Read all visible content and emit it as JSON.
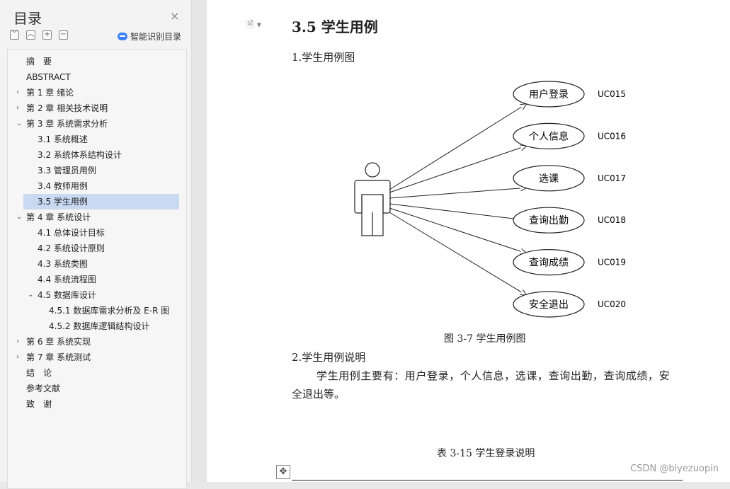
{
  "sidebar": {
    "title": "目录",
    "close_symbol": "×",
    "tools": [
      "﹀",
      "︿",
      "+",
      "−"
    ],
    "smart_label": "智能识别目录",
    "items": [
      {
        "label": "摘　要",
        "level": 1,
        "arrow": ""
      },
      {
        "label": "ABSTRACT",
        "level": 1,
        "arrow": ""
      },
      {
        "label": "第 1 章  绪论",
        "level": 1,
        "arrow": "›"
      },
      {
        "label": "第 2 章  相关技术说明",
        "level": 1,
        "arrow": "›"
      },
      {
        "label": "第 3 章  系统需求分析",
        "level": 1,
        "arrow": "⌄"
      },
      {
        "label": "3.1 系统概述",
        "level": 2,
        "arrow": ""
      },
      {
        "label": "3.2 系统体系结构设计",
        "level": 2,
        "arrow": ""
      },
      {
        "label": "3.3 管理员用例",
        "level": 2,
        "arrow": ""
      },
      {
        "label": "3.4 教师用例",
        "level": 2,
        "arrow": ""
      },
      {
        "label": "3.5 学生用例",
        "level": 2,
        "arrow": "",
        "selected": true
      },
      {
        "label": "第 4 章  系统设计",
        "level": 1,
        "arrow": "⌄"
      },
      {
        "label": "4.1 总体设计目标",
        "level": 2,
        "arrow": ""
      },
      {
        "label": "4.2 系统设计原则",
        "level": 2,
        "arrow": ""
      },
      {
        "label": "4.3 系统类图",
        "level": 2,
        "arrow": ""
      },
      {
        "label": "4.4 系统流程图",
        "level": 2,
        "arrow": ""
      },
      {
        "label": "4.5 数据库设计",
        "level": 2,
        "arrow": "⌄"
      },
      {
        "label": "4.5.1 数据库需求分析及 E-R 图",
        "level": 3,
        "arrow": ""
      },
      {
        "label": "4.5.2  数据库逻辑结构设计",
        "level": 3,
        "arrow": ""
      },
      {
        "label": "第 6 章  系统实现",
        "level": 1,
        "arrow": "›"
      },
      {
        "label": "第 7 章  系统测试",
        "level": 1,
        "arrow": "›"
      },
      {
        "label": "结　论",
        "level": 1,
        "arrow": ""
      },
      {
        "label": "参考文献",
        "level": 1,
        "arrow": ""
      },
      {
        "label": "致　谢",
        "level": 1,
        "arrow": ""
      }
    ]
  },
  "document": {
    "doc_icon": "🗎 ▾",
    "heading": "3.5 学生用例",
    "sub1": "1.学生用例图",
    "figure_caption": "图 3-7   学生用例图",
    "sub2": "2.学生用例说明",
    "para_line1": "学生用例主要有：用户登录，个人信息，选课，查询出勤，查询成绩，安",
    "para_line2": "全退出等。",
    "table_caption": "表 3-15   学生登录说明",
    "move_symbol": "✥"
  },
  "diagram": {
    "use_cases": [
      {
        "label": "用户登录",
        "code": "UC015"
      },
      {
        "label": "个人信息",
        "code": "UC016"
      },
      {
        "label": "选课",
        "code": "UC017"
      },
      {
        "label": "查询出勤",
        "code": "UC018"
      },
      {
        "label": "查询成绩",
        "code": "UC019"
      },
      {
        "label": "安全退出",
        "code": "UC020"
      }
    ]
  },
  "watermark": "CSDN @biyezuopin"
}
